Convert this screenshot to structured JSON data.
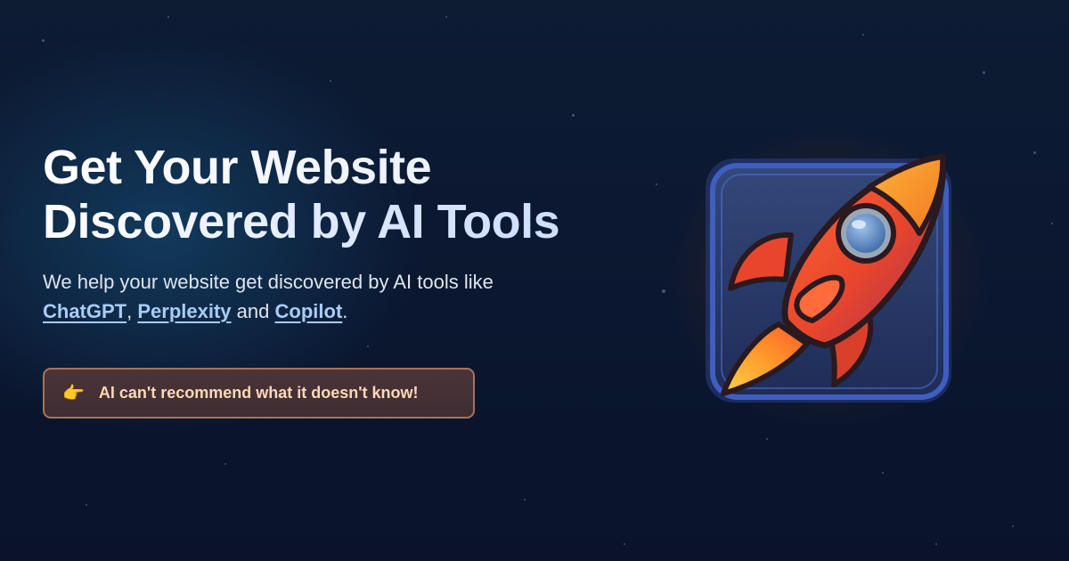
{
  "hero": {
    "title_line1": "Get Your Website",
    "title_line2": "Discovered by AI Tools",
    "subtitle_text": "We help your website get discovered by AI tools like",
    "links": [
      "ChatGPT",
      "Perplexity",
      "Copilot"
    ],
    "sep1": ",",
    "sep2": "and",
    "end": "."
  },
  "callout": {
    "emoji": "👉",
    "text": "AI can't recommend what it doesn't know!"
  },
  "icons": {
    "rocket": "rocket-icon",
    "pointer": "pointing-hand-icon"
  },
  "colors": {
    "background": "#0b1730",
    "link": "#a9ccf6",
    "callout_border": "#a8725a",
    "callout_text": "#ffd9b6"
  }
}
